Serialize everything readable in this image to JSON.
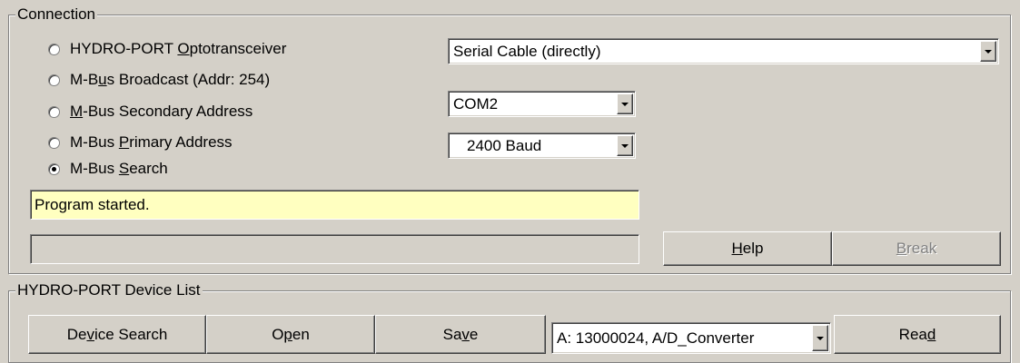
{
  "connection": {
    "legend": "Connection",
    "options": [
      {
        "pre": "HYDRO-PORT ",
        "key": "O",
        "post": "ptotransceiver",
        "selected": false
      },
      {
        "pre": "M-B",
        "key": "u",
        "post": "s Broadcast (Addr: 254)",
        "selected": false
      },
      {
        "pre": "",
        "key": "M",
        "post": "-Bus Secondary Address",
        "selected": false
      },
      {
        "pre": "M-Bus ",
        "key": "P",
        "post": "rimary Address",
        "selected": false
      },
      {
        "pre": "M-Bus ",
        "key": "S",
        "post": "earch",
        "selected": true
      }
    ],
    "interface_value": "Serial Cable (directly)",
    "port_value": "COM2",
    "baud_value": "2400 Baud",
    "status_text": "Program started.",
    "help_button": {
      "key": "H",
      "post": "elp"
    },
    "break_button": {
      "key": "B",
      "post": "reak",
      "enabled": false
    }
  },
  "device_list": {
    "legend": "HYDRO-PORT Device List",
    "device_search_button": {
      "pre": "De",
      "key": "v",
      "post": "ice Search"
    },
    "open_button": {
      "pre": "O",
      "key": "p",
      "post": "en"
    },
    "save_button": {
      "pre": "Sa",
      "key": "v",
      "post": "e"
    },
    "device_value": "A: 13000024, A/D_Converter",
    "read_button": {
      "pre": "Rea",
      "key": "d",
      "post": ""
    }
  }
}
